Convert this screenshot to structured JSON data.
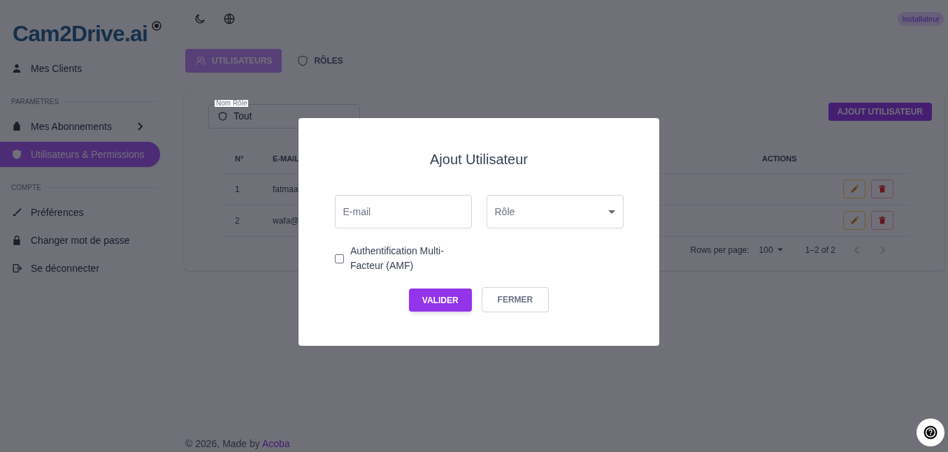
{
  "logo": {
    "text": "Cam2Drive.ai"
  },
  "sidebar": {
    "items": [
      {
        "kind": "item",
        "label": "Mes Clients",
        "selected": false
      },
      {
        "kind": "section",
        "label": "PARAMÉTRES"
      },
      {
        "kind": "item",
        "label": "Mes Abonnements",
        "selected": false,
        "has_children": true
      },
      {
        "kind": "item",
        "label": "Utilisateurs & Permissions",
        "selected": true
      },
      {
        "kind": "section",
        "label": "COMPTE"
      },
      {
        "kind": "item",
        "label": "Préférences",
        "selected": false
      },
      {
        "kind": "item",
        "label": "Changer mot de passe",
        "selected": false
      },
      {
        "kind": "item",
        "label": "Se déconnecter",
        "selected": false
      }
    ]
  },
  "header": {
    "role_badge": "Installateur"
  },
  "tabs": [
    {
      "label": "UTILISATEURS",
      "selected": true
    },
    {
      "label": "RÔLES",
      "selected": false
    }
  ],
  "filter": {
    "label": "Nom Rôle",
    "value": "Tout"
  },
  "add_button": "AJOUT UTILISATEUR",
  "table": {
    "columns": [
      "N°",
      "E-MAIL",
      "ACTIONS"
    ],
    "rows": [
      {
        "number": "1",
        "email": "fatmaa"
      },
      {
        "number": "2",
        "email": "wafa@"
      }
    ]
  },
  "pagination": {
    "rows_per_page_label": "Rows per page:",
    "rows_per_page": "100",
    "range": "1–2 of 2"
  },
  "footer": {
    "text": "© 2026, Made by ",
    "link": "Acoba"
  },
  "dialog": {
    "title": "Ajout Utilisateur",
    "email_placeholder": "E-mail",
    "role_placeholder": "Rôle",
    "mfa": {
      "label": "Authentification Multi-Facteur (AMF)",
      "checked": false
    },
    "buttons": [
      {
        "kind": "primary",
        "label": "VALIDER"
      },
      {
        "kind": "outline",
        "label": "FERMER"
      }
    ]
  }
}
